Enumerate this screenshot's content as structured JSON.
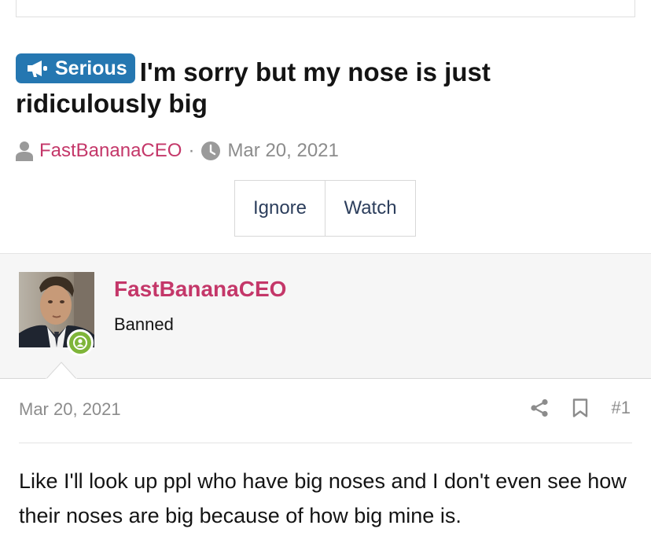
{
  "thread": {
    "prefix": "Serious",
    "title": "I'm sorry but my nose is just ridiculously big",
    "author": "FastBananaCEO",
    "separator": "·",
    "date": "Mar 20, 2021"
  },
  "actions": {
    "ignore": "Ignore",
    "watch": "Watch"
  },
  "post": {
    "username": "FastBananaCEO",
    "user_title": "Banned",
    "date": "Mar 20, 2021",
    "number": "#1",
    "body": "Like I'll look up ppl who have big noses and I don't even see how their noses are big because of how big mine is."
  },
  "icons": {
    "prefix_icon": "megaphone-icon",
    "author_icon": "user-icon",
    "date_icon": "clock-icon",
    "share_icon": "share-icon",
    "bookmark_icon": "bookmark-icon",
    "online_icon": "online-user-icon"
  },
  "colors": {
    "prefix_bg": "#2577b1",
    "username": "#c43769",
    "online": "#7fb539",
    "muted": "#8c8c8c"
  }
}
